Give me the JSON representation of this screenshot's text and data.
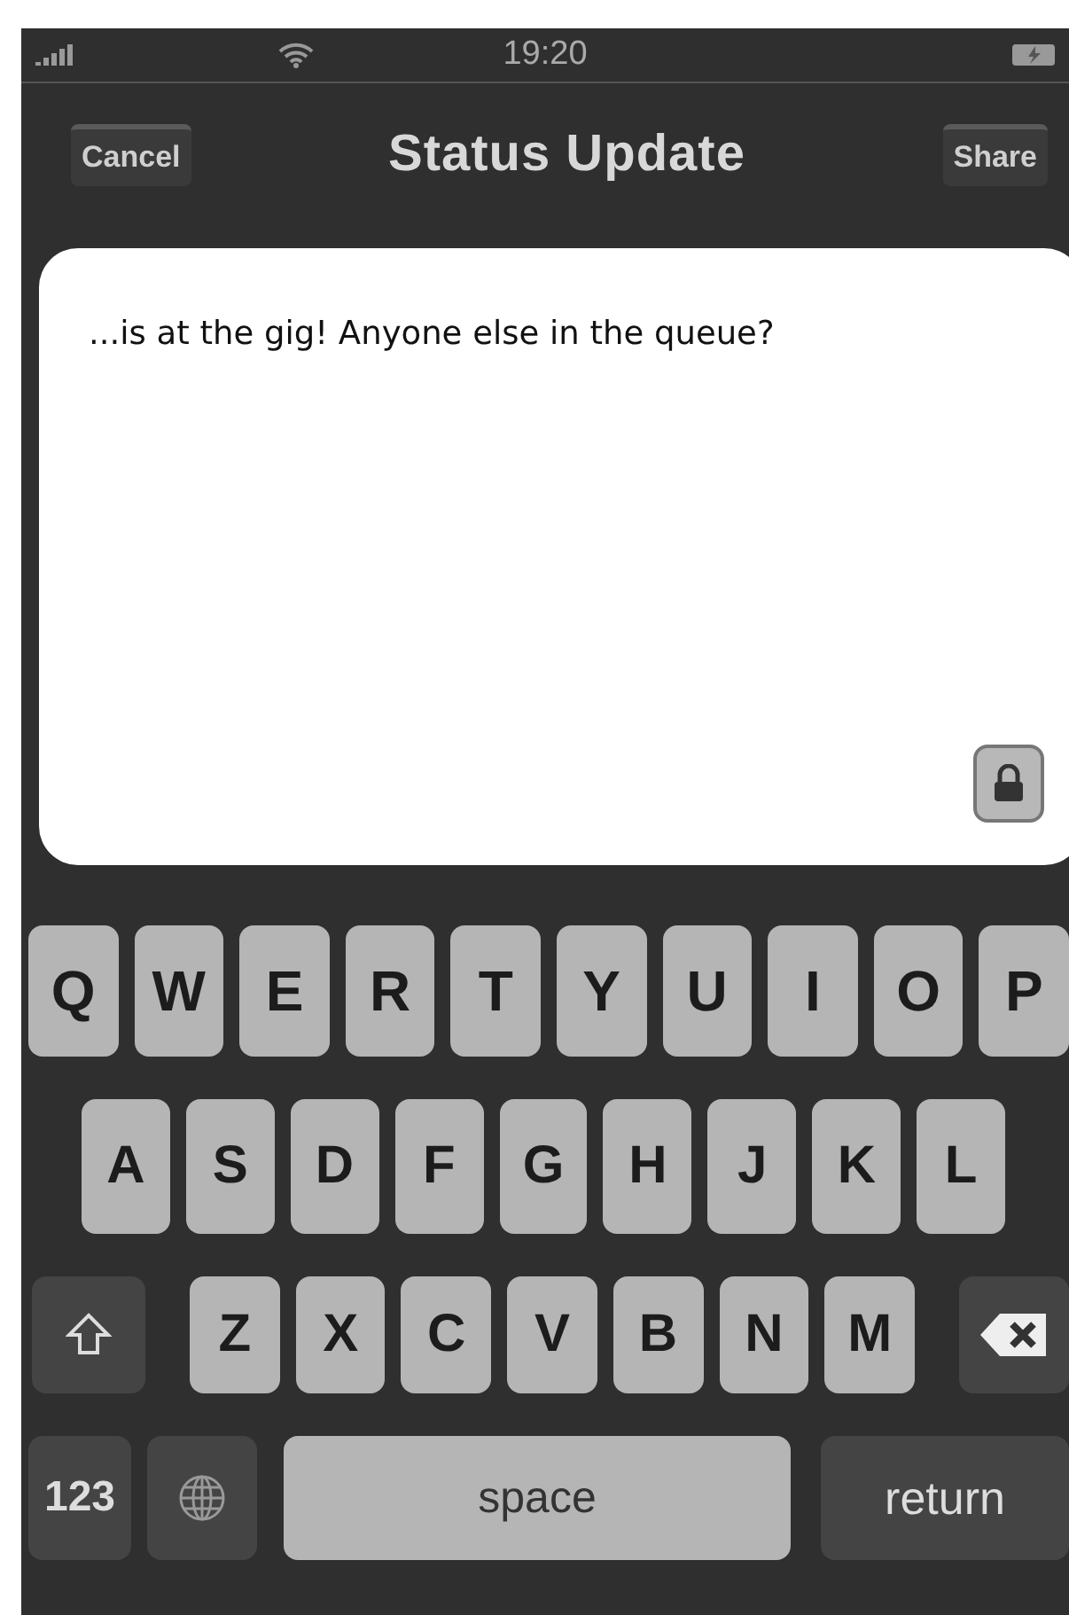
{
  "status_bar": {
    "time": "19:20"
  },
  "nav_bar": {
    "left_button": "Cancel",
    "title": "Status Update",
    "right_button": "Share"
  },
  "status_text": "...is at the gig! Anyone else in the queue?",
  "keyboard": [
    {
      "keys": [
        {
          "kind": "letter",
          "label": "Q"
        },
        {
          "kind": "letter",
          "label": "W"
        },
        {
          "kind": "letter",
          "label": "E"
        },
        {
          "kind": "letter",
          "label": "R"
        },
        {
          "kind": "letter",
          "label": "T"
        },
        {
          "kind": "letter",
          "label": "Y"
        },
        {
          "kind": "letter",
          "label": "U"
        },
        {
          "kind": "letter",
          "label": "I"
        },
        {
          "kind": "letter",
          "label": "O"
        },
        {
          "kind": "letter",
          "label": "P"
        }
      ]
    },
    {
      "keys": [
        {
          "kind": "letter",
          "label": "A"
        },
        {
          "kind": "letter",
          "label": "S"
        },
        {
          "kind": "letter",
          "label": "D"
        },
        {
          "kind": "letter",
          "label": "F"
        },
        {
          "kind": "letter",
          "label": "G"
        },
        {
          "kind": "letter",
          "label": "H"
        },
        {
          "kind": "letter",
          "label": "J"
        },
        {
          "kind": "letter",
          "label": "K"
        },
        {
          "kind": "letter",
          "label": "L"
        }
      ]
    },
    {
      "keys": [
        {
          "kind": "shift"
        },
        {
          "kind": "letter",
          "label": "Z"
        },
        {
          "kind": "letter",
          "label": "X"
        },
        {
          "kind": "letter",
          "label": "C"
        },
        {
          "kind": "letter",
          "label": "V"
        },
        {
          "kind": "letter",
          "label": "B"
        },
        {
          "kind": "letter",
          "label": "N"
        },
        {
          "kind": "letter",
          "label": "M"
        },
        {
          "kind": "delete"
        }
      ]
    },
    {
      "keys": [
        {
          "kind": "numbers",
          "label": "123"
        },
        {
          "kind": "globe"
        },
        {
          "kind": "space",
          "label": "space"
        },
        {
          "kind": "return",
          "label": "return"
        }
      ]
    }
  ]
}
